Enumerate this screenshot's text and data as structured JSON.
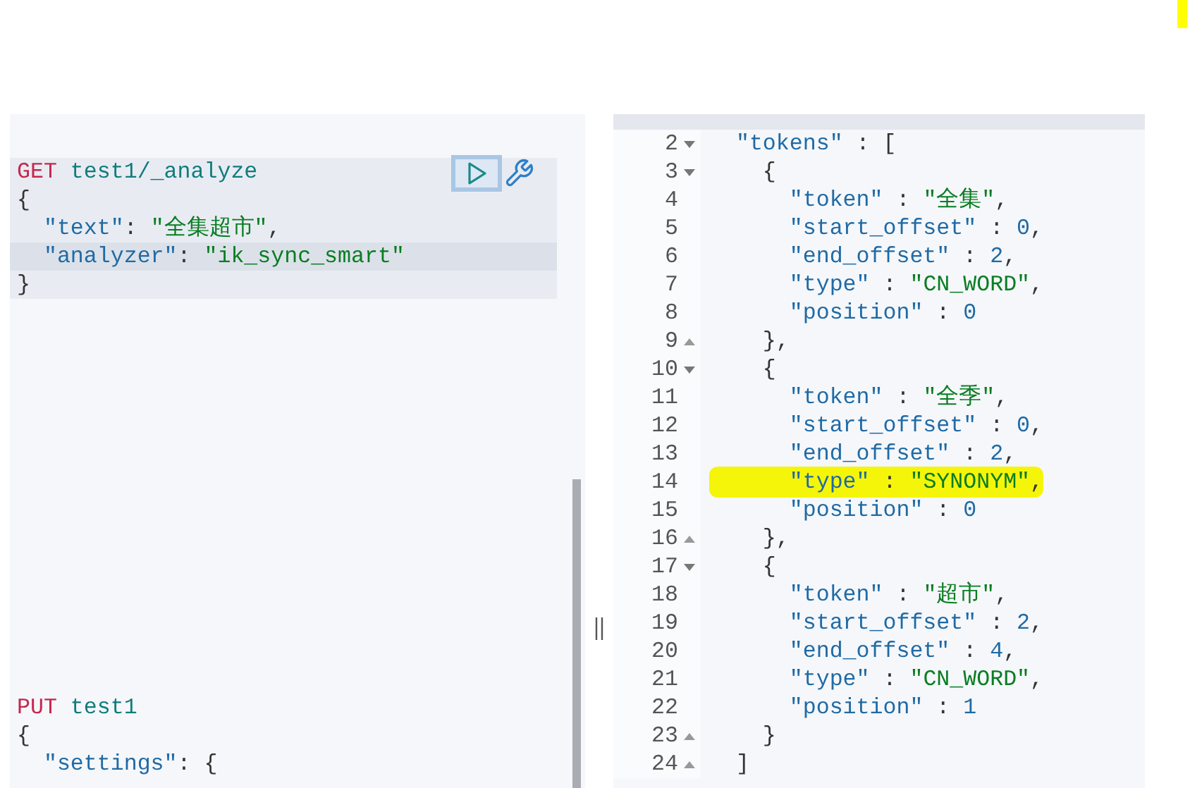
{
  "request_editor": {
    "lines": [
      {
        "tokens": [
          {
            "kind": "method",
            "text": "GET"
          },
          {
            "kind": "path",
            "text": " test1/_analyze"
          }
        ],
        "in_block": true,
        "active": false
      },
      {
        "tokens": [
          {
            "kind": "punct",
            "text": "{"
          }
        ],
        "in_block": true,
        "active": false
      },
      {
        "tokens": [
          {
            "kind": "key",
            "text": "  \"text\""
          },
          {
            "kind": "punct",
            "text": ": "
          },
          {
            "kind": "string",
            "text": "\"全集超市\""
          },
          {
            "kind": "punct",
            "text": ","
          }
        ],
        "in_block": true,
        "active": false
      },
      {
        "tokens": [
          {
            "kind": "key",
            "text": "  \"analyzer\""
          },
          {
            "kind": "punct",
            "text": ": "
          },
          {
            "kind": "string",
            "text": "\"ik_sync_smart\""
          }
        ],
        "in_block": true,
        "active": true
      },
      {
        "tokens": [
          {
            "kind": "punct",
            "text": "}"
          }
        ],
        "in_block": true,
        "active": false
      },
      {
        "tokens": [
          {
            "kind": "method",
            "text": "PUT"
          },
          {
            "kind": "path",
            "text": " test1"
          }
        ],
        "in_block": false,
        "active": false
      },
      {
        "tokens": [
          {
            "kind": "punct",
            "text": "{"
          }
        ],
        "in_block": false,
        "active": false
      },
      {
        "tokens": [
          {
            "kind": "key",
            "text": "  \"settings\""
          },
          {
            "kind": "punct",
            "text": ": {"
          }
        ],
        "in_block": false,
        "active": false
      }
    ]
  },
  "response_editor": {
    "lines": [
      {
        "number": "2",
        "fold_start": true,
        "fold_end": false,
        "highlighted": false,
        "tokens": [
          {
            "kind": "key",
            "text": "  \"tokens\""
          },
          {
            "kind": "punct",
            "text": " : ["
          }
        ]
      },
      {
        "number": "3",
        "fold_start": true,
        "fold_end": false,
        "highlighted": false,
        "tokens": [
          {
            "kind": "punct",
            "text": "    {"
          }
        ]
      },
      {
        "number": "4",
        "fold_start": false,
        "fold_end": false,
        "highlighted": false,
        "tokens": [
          {
            "kind": "key",
            "text": "      \"token\""
          },
          {
            "kind": "punct",
            "text": " : "
          },
          {
            "kind": "string",
            "text": "\"全集\""
          },
          {
            "kind": "punct",
            "text": ","
          }
        ]
      },
      {
        "number": "5",
        "fold_start": false,
        "fold_end": false,
        "highlighted": false,
        "tokens": [
          {
            "kind": "key",
            "text": "      \"start_offset\""
          },
          {
            "kind": "punct",
            "text": " : "
          },
          {
            "kind": "number",
            "text": "0"
          },
          {
            "kind": "punct",
            "text": ","
          }
        ]
      },
      {
        "number": "6",
        "fold_start": false,
        "fold_end": false,
        "highlighted": false,
        "tokens": [
          {
            "kind": "key",
            "text": "      \"end_offset\""
          },
          {
            "kind": "punct",
            "text": " : "
          },
          {
            "kind": "number",
            "text": "2"
          },
          {
            "kind": "punct",
            "text": ","
          }
        ]
      },
      {
        "number": "7",
        "fold_start": false,
        "fold_end": false,
        "highlighted": false,
        "tokens": [
          {
            "kind": "key",
            "text": "      \"type\""
          },
          {
            "kind": "punct",
            "text": " : "
          },
          {
            "kind": "string",
            "text": "\"CN_WORD\""
          },
          {
            "kind": "punct",
            "text": ","
          }
        ]
      },
      {
        "number": "8",
        "fold_start": false,
        "fold_end": false,
        "highlighted": false,
        "tokens": [
          {
            "kind": "key",
            "text": "      \"position\""
          },
          {
            "kind": "punct",
            "text": " : "
          },
          {
            "kind": "number",
            "text": "0"
          }
        ]
      },
      {
        "number": "9",
        "fold_start": false,
        "fold_end": true,
        "highlighted": false,
        "tokens": [
          {
            "kind": "punct",
            "text": "    },"
          }
        ]
      },
      {
        "number": "10",
        "fold_start": true,
        "fold_end": false,
        "highlighted": false,
        "tokens": [
          {
            "kind": "punct",
            "text": "    {"
          }
        ]
      },
      {
        "number": "11",
        "fold_start": false,
        "fold_end": false,
        "highlighted": false,
        "tokens": [
          {
            "kind": "key",
            "text": "      \"token\""
          },
          {
            "kind": "punct",
            "text": " : "
          },
          {
            "kind": "string",
            "text": "\"全季\""
          },
          {
            "kind": "punct",
            "text": ","
          }
        ]
      },
      {
        "number": "12",
        "fold_start": false,
        "fold_end": false,
        "highlighted": false,
        "tokens": [
          {
            "kind": "key",
            "text": "      \"start_offset\""
          },
          {
            "kind": "punct",
            "text": " : "
          },
          {
            "kind": "number",
            "text": "0"
          },
          {
            "kind": "punct",
            "text": ","
          }
        ]
      },
      {
        "number": "13",
        "fold_start": false,
        "fold_end": false,
        "highlighted": false,
        "tokens": [
          {
            "kind": "key",
            "text": "      \"end_offset\""
          },
          {
            "kind": "punct",
            "text": " : "
          },
          {
            "kind": "number",
            "text": "2"
          },
          {
            "kind": "punct",
            "text": ","
          }
        ]
      },
      {
        "number": "14",
        "fold_start": false,
        "fold_end": false,
        "highlighted": true,
        "tokens": [
          {
            "kind": "key",
            "text": "      \"type\""
          },
          {
            "kind": "punct",
            "text": " : "
          },
          {
            "kind": "string",
            "text": "\"SYNONYM\""
          },
          {
            "kind": "punct",
            "text": ","
          }
        ]
      },
      {
        "number": "15",
        "fold_start": false,
        "fold_end": false,
        "highlighted": false,
        "tokens": [
          {
            "kind": "key",
            "text": "      \"position\""
          },
          {
            "kind": "punct",
            "text": " : "
          },
          {
            "kind": "number",
            "text": "0"
          }
        ]
      },
      {
        "number": "16",
        "fold_start": false,
        "fold_end": true,
        "highlighted": false,
        "tokens": [
          {
            "kind": "punct",
            "text": "    },"
          }
        ]
      },
      {
        "number": "17",
        "fold_start": true,
        "fold_end": false,
        "highlighted": false,
        "tokens": [
          {
            "kind": "punct",
            "text": "    {"
          }
        ]
      },
      {
        "number": "18",
        "fold_start": false,
        "fold_end": false,
        "highlighted": false,
        "tokens": [
          {
            "kind": "key",
            "text": "      \"token\""
          },
          {
            "kind": "punct",
            "text": " : "
          },
          {
            "kind": "string",
            "text": "\"超市\""
          },
          {
            "kind": "punct",
            "text": ","
          }
        ]
      },
      {
        "number": "19",
        "fold_start": false,
        "fold_end": false,
        "highlighted": false,
        "tokens": [
          {
            "kind": "key",
            "text": "      \"start_offset\""
          },
          {
            "kind": "punct",
            "text": " : "
          },
          {
            "kind": "number",
            "text": "2"
          },
          {
            "kind": "punct",
            "text": ","
          }
        ]
      },
      {
        "number": "20",
        "fold_start": false,
        "fold_end": false,
        "highlighted": false,
        "tokens": [
          {
            "kind": "key",
            "text": "      \"end_offset\""
          },
          {
            "kind": "punct",
            "text": " : "
          },
          {
            "kind": "number",
            "text": "4"
          },
          {
            "kind": "punct",
            "text": ","
          }
        ]
      },
      {
        "number": "21",
        "fold_start": false,
        "fold_end": false,
        "highlighted": false,
        "tokens": [
          {
            "kind": "key",
            "text": "      \"type\""
          },
          {
            "kind": "punct",
            "text": " : "
          },
          {
            "kind": "string",
            "text": "\"CN_WORD\""
          },
          {
            "kind": "punct",
            "text": ","
          }
        ]
      },
      {
        "number": "22",
        "fold_start": false,
        "fold_end": false,
        "highlighted": false,
        "tokens": [
          {
            "kind": "key",
            "text": "      \"position\""
          },
          {
            "kind": "punct",
            "text": " : "
          },
          {
            "kind": "number",
            "text": "1"
          }
        ]
      },
      {
        "number": "23",
        "fold_start": false,
        "fold_end": true,
        "highlighted": false,
        "tokens": [
          {
            "kind": "punct",
            "text": "    }"
          }
        ]
      },
      {
        "number": "24",
        "fold_start": false,
        "fold_end": true,
        "highlighted": false,
        "tokens": [
          {
            "kind": "punct",
            "text": "  ]"
          }
        ]
      }
    ]
  }
}
